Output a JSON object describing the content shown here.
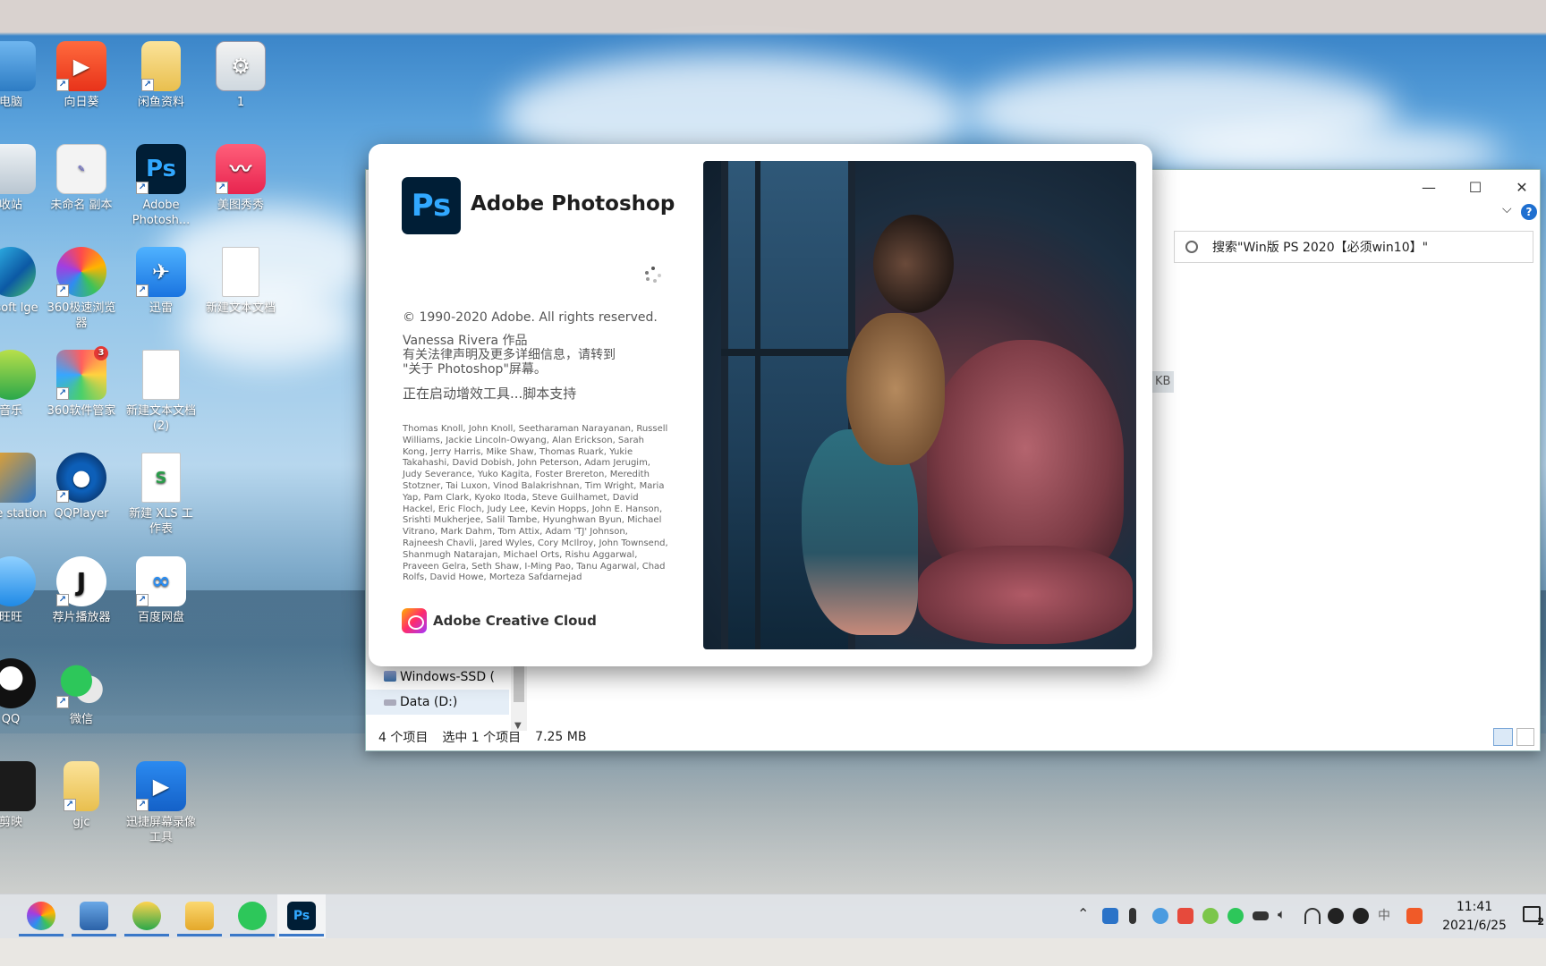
{
  "desktop": {
    "icons": [
      {
        "label": "电脑"
      },
      {
        "label": "向日葵"
      },
      {
        "label": "闲鱼资料"
      },
      {
        "label": "1"
      },
      {
        "label": "收站"
      },
      {
        "label": "未命名 副本"
      },
      {
        "label": "Adobe Photosh..."
      },
      {
        "label": "美图秀秀"
      },
      {
        "label": "rosoft lge"
      },
      {
        "label": "360极速浏览器"
      },
      {
        "label": "迅雷"
      },
      {
        "label": "新建文本文档"
      },
      {
        "label": "音乐"
      },
      {
        "label": "360软件管家"
      },
      {
        "label": "新建文本文档 (2)"
      },
      {
        "label": "ware station"
      },
      {
        "label": "QQPlayer"
      },
      {
        "label": "新建 XLS 工作表"
      },
      {
        "label": "旺旺"
      },
      {
        "label": "荐片播放器"
      },
      {
        "label": "百度网盘"
      },
      {
        "label": "QQ"
      },
      {
        "label": "微信"
      },
      {
        "label": "剪映"
      },
      {
        "label": "gjc"
      },
      {
        "label": "迅捷屏幕录像工具"
      }
    ],
    "badge_360": "3"
  },
  "explorer": {
    "search_placeholder": "搜索\"Win版 PS 2020【必须win10】\"",
    "size_col": "KB",
    "nav": [
      {
        "label": "Windows-SSD ("
      },
      {
        "label": "Data (D:)"
      }
    ],
    "status": {
      "count": "4 个项目",
      "selected": "选中 1 个项目",
      "size": "7.25 MB"
    },
    "controls": {
      "minimize": "—",
      "maximize": "☐",
      "close": "✕",
      "help": "?",
      "chevron": "⌵"
    }
  },
  "splash": {
    "logo": "Ps",
    "title": "Adobe Photoshop",
    "copyright": "© 1990-2020 Adobe. All rights reserved.",
    "artwork_author": "Vanessa Rivera 作品",
    "legal_line1": "有关法律声明及更多详细信息，请转到",
    "legal_line2": "\"关于 Photoshop\"屏幕。",
    "loading": "正在启动增效工具...脚本支持",
    "credits": "Thomas Knoll, John Knoll, Seetharaman Narayanan, Russell Williams, Jackie Lincoln-Owyang, Alan Erickson, Sarah Kong, Jerry Harris, Mike Shaw, Thomas Ruark, Yukie Takahashi, David Dobish, John Peterson, Adam Jerugim, Judy Severance, Yuko Kagita, Foster Brereton, Meredith Stotzner, Tai Luxon, Vinod Balakrishnan, Tim Wright, Maria Yap, Pam Clark, Kyoko Itoda, Steve Guilhamet, David Hackel, Eric Floch, Judy Lee, Kevin Hopps, John E. Hanson, Srishti Mukherjee, Salil Tambe, Hyunghwan Byun, Michael Vitrano, Mark Dahm, Tom Attix, Adam 'TJ' Johnson, Rajneesh Chavli, Jared Wyles, Cory McIlroy, John Townsend, Shanmugh Natarajan, Michael Orts, Rishu Aggarwal, Praveen Gelra, Seth Shaw, I-Ming Pao, Tanu Agarwal, Chad Rolfs, David Howe, Morteza Safdarnejad",
    "creative_cloud": "Adobe Creative Cloud"
  },
  "taskbar": {
    "apps": [
      {
        "name": "360-browser"
      },
      {
        "name": "network-tool"
      },
      {
        "name": "music"
      },
      {
        "name": "file-explorer"
      },
      {
        "name": "wechat"
      },
      {
        "name": "photoshop",
        "label": "Ps"
      }
    ],
    "clock_time": "11:41",
    "clock_date": "2021/6/25",
    "ime": "中",
    "notif_count": "2"
  },
  "colors": {
    "ps_bg": "#001e36",
    "ps_fg": "#31a8ff",
    "taskbar_active": "#3a78c8"
  }
}
